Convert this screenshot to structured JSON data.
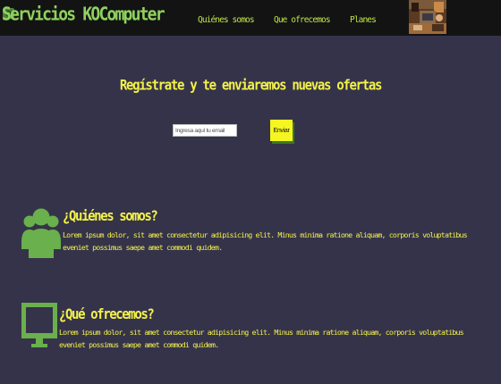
{
  "colors": {
    "background": "#35334a",
    "header_bg": "#131313",
    "accent": "#6ab04c",
    "brand_text": "#8fd15f",
    "nav_text": "#bfe34a",
    "heading_text": "#f3f24a",
    "button_bg": "#f4f521",
    "button_shadow": "#3c7a1e"
  },
  "header": {
    "brand": "Servicios KOComputer",
    "logo_icon": "gear-logo-icon",
    "nav": [
      {
        "label": "Quiénes somos"
      },
      {
        "label": "Que ofrecemos"
      },
      {
        "label": "Planes"
      }
    ],
    "photo": "workbench-photo"
  },
  "signup": {
    "title": "Regístrate y te enviaremos nuevas ofertas",
    "email_placeholder": "Ingresa aquí tu email",
    "button_label": "Enviar"
  },
  "sections": [
    {
      "icon": "users-icon",
      "title": "¿Quiénes somos?",
      "text": "Lorem ipsum dolor, sit amet consectetur adipisicing elit. Minus minima ratione aliquam, corporis voluptatibus eveniet possimus saepe amet commodi quidem."
    },
    {
      "icon": "monitor-icon",
      "title": "¿Qué ofrecemos?",
      "text": "Lorem ipsum dolor, sit amet consectetur adipisicing elit. Minus minima ratione aliquam, corporis voluptatibus eveniet possimus saepe amet commodi quidem."
    }
  ]
}
